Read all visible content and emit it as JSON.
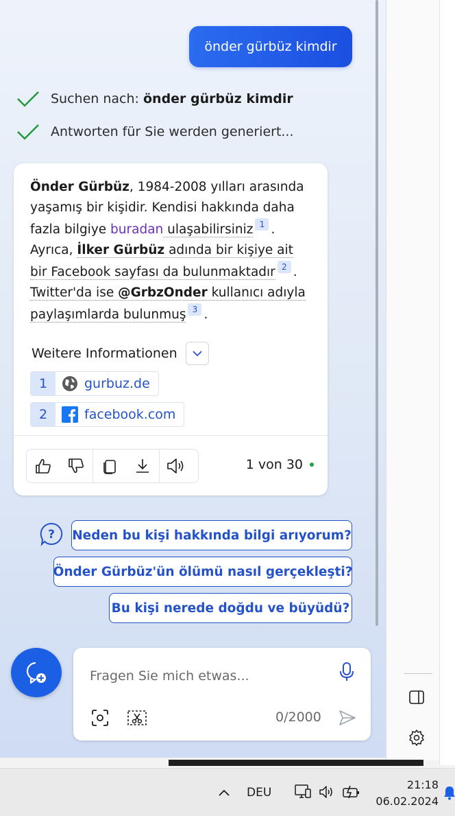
{
  "user_message": "önder gürbüz kimdir",
  "status": {
    "search_prefix": "Suchen nach: ",
    "search_query": "önder gürbüz kimdir",
    "generating": "Antworten für Sie werden generiert..."
  },
  "answer": {
    "p1_bold": "Önder Gürbüz",
    "p1_rest": ", 1984-2008 yılları arasında yaşamış bir kişidir. Kendisi hakkında daha fazla bilgiye ",
    "p1_link": "buradan",
    "p1_tail": " ulaşabilirsiniz",
    "cite1": "1",
    "sent2_a": "Ayrıca, ",
    "sent2_bold": "İlker Gürbüz",
    "sent2_b": " adında bir kişiye ait bir Facebook sayfası da bulunmaktadır",
    "cite2": "2",
    "sent3_a": "Twitter'da ise ",
    "sent3_bold": "@GrbzOnder",
    "sent3_b": " kullanıcı adıyla paylaşımlarda bulunmuş",
    "cite3": "3",
    "period": "."
  },
  "more_info": {
    "label": "Weitere Informationen",
    "sources": [
      {
        "num": "1",
        "label": "gurbuz.de",
        "icon": "globe-icon"
      },
      {
        "num": "2",
        "label": "facebook.com",
        "icon": "facebook-icon"
      }
    ]
  },
  "page_count": "1 von 30",
  "suggestions": [
    "Neden bu kişi hakkında bilgi arıyorum?",
    "Önder Gürbüz'ün ölümü nasıl gerçekleşti?",
    "Bu kişi nerede doğdu ve büyüdü?"
  ],
  "input": {
    "placeholder": "Fragen Sie mich etwas...",
    "char_count": "0/2000"
  },
  "taskbar": {
    "language": "DEU",
    "time": "21:18",
    "date": "06.02.2024"
  },
  "colors": {
    "accent": "#1b5fe4",
    "link": "#2452c9",
    "check": "#1f9a3a"
  }
}
